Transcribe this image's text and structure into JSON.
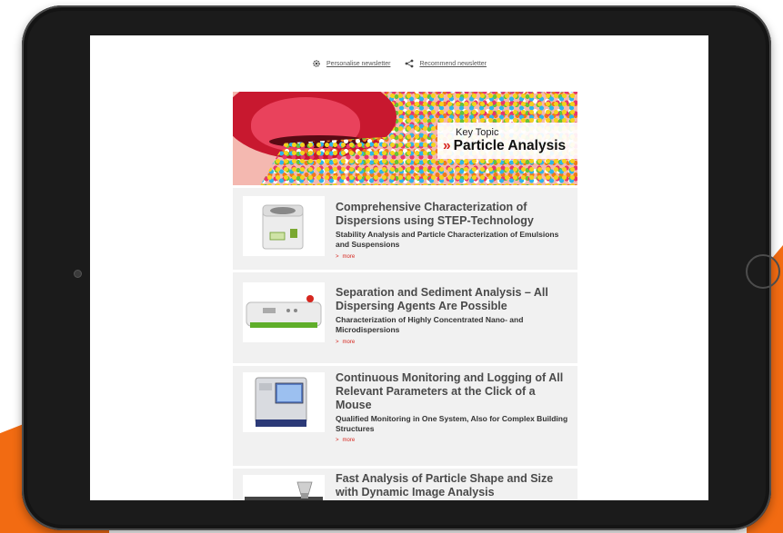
{
  "topbar": {
    "personalise_label": "Personalise newsletter",
    "recommend_label": "Recommend newsletter",
    "personalise_icon": "gear-icon",
    "recommend_icon": "share-icon"
  },
  "hero": {
    "kicker": "Key Topic",
    "chevrons": "»",
    "title": "Particle Analysis"
  },
  "articles": [
    {
      "title": "Comprehensive Characterization of Dispersions using STEP-Technology",
      "subtitle": "Stability Analysis and Particle Characterization of Emulsions and Suspensions",
      "more_label": "more",
      "arrow": ">"
    },
    {
      "title": "Separation and Sediment Analysis – All Dispersing Agents Are Possible",
      "subtitle": "Characterization of Highly Concentrated Nano- and Microdispersions",
      "more_label": "more",
      "arrow": ">"
    },
    {
      "title": "Continuous Monitoring and Logging of All Relevant Parameters at the Click of a Mouse",
      "subtitle": "Qualified Monitoring in One System, Also for Complex Building Structures",
      "more_label": "more",
      "arrow": ">"
    },
    {
      "title": "Fast Analysis of Particle Shape and Size with Dynamic Image Analysis",
      "subtitle": "",
      "more_label": "",
      "arrow": ""
    }
  ],
  "colors": {
    "accent_red": "#d6271f",
    "brand_orange": "#f26b12",
    "tablet_frame": "#1b1b1b"
  }
}
